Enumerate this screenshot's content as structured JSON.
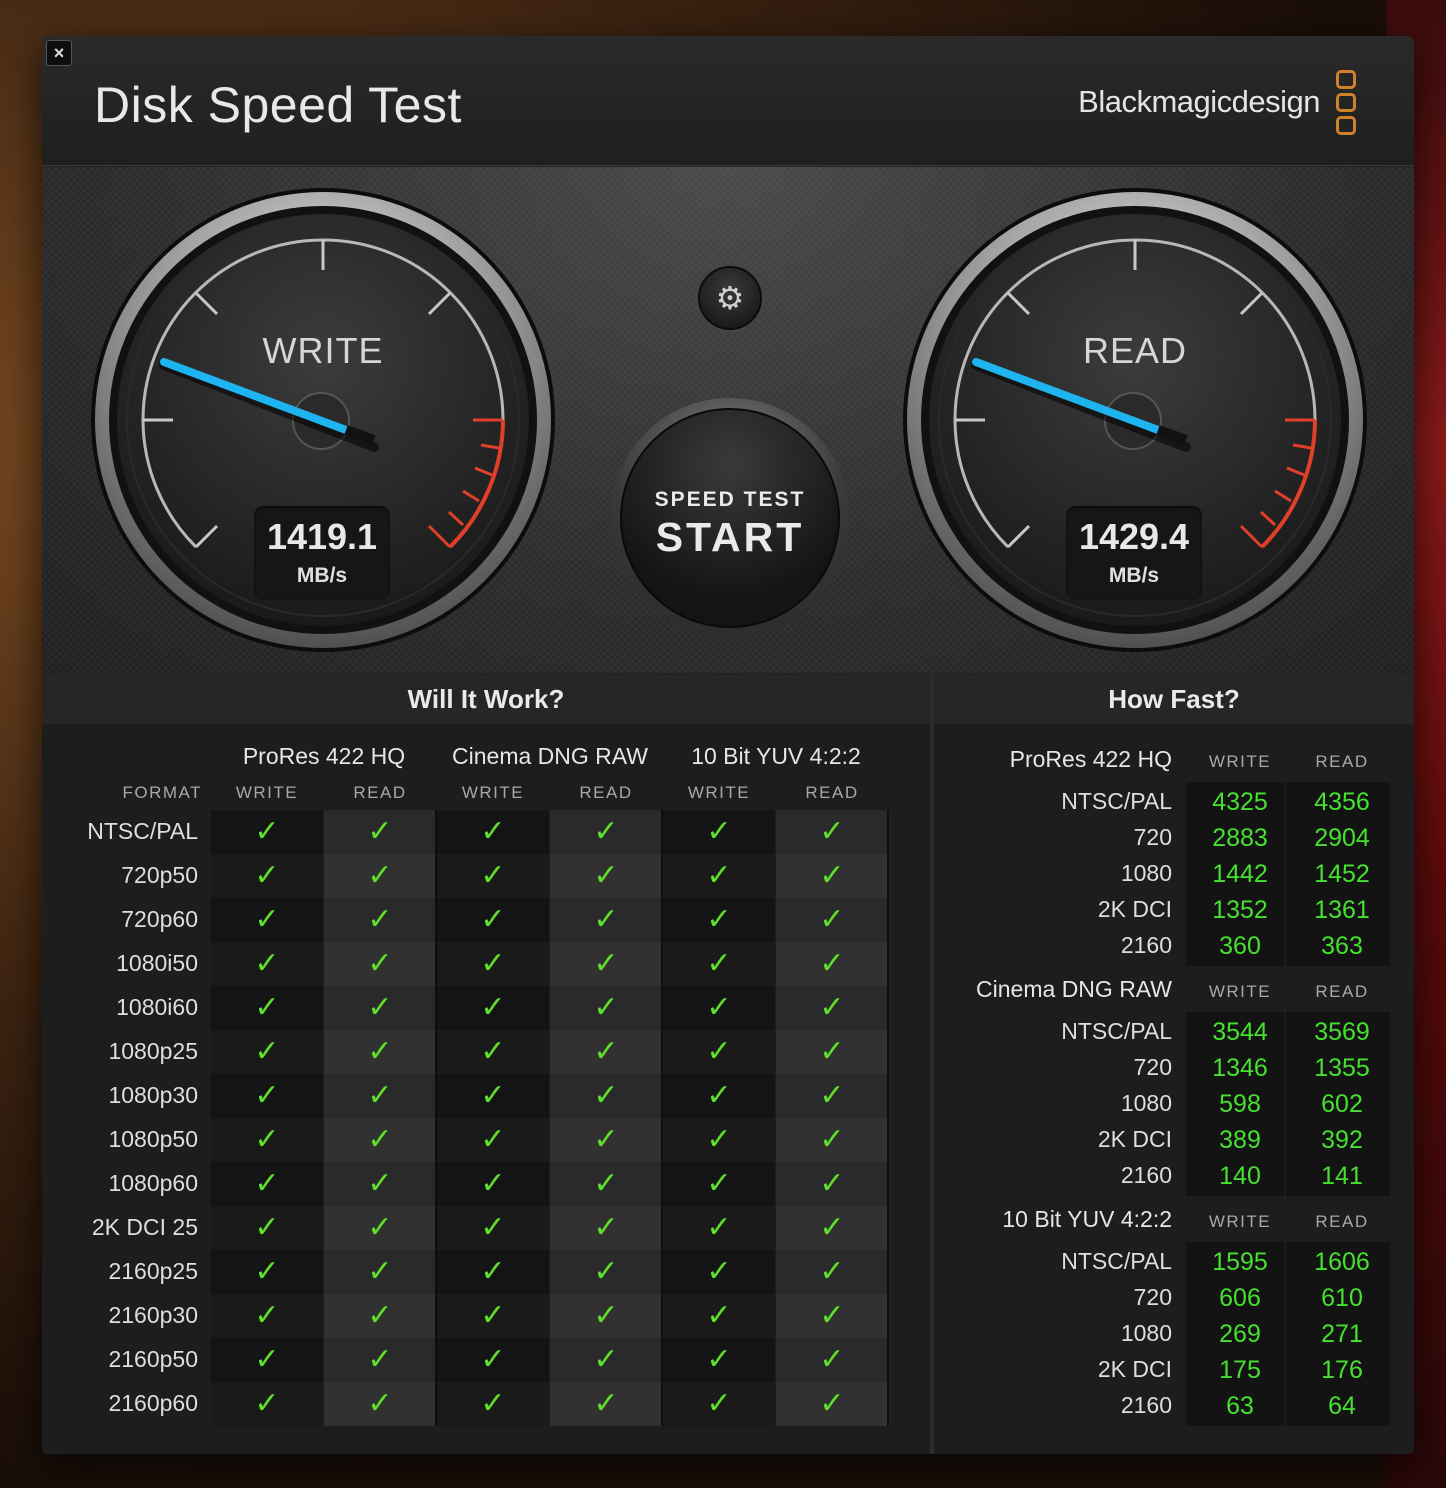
{
  "window": {
    "close_glyph": "×"
  },
  "header": {
    "title": "Disk Speed Test",
    "brand": "Blackmagicdesign",
    "brand_color": "#d0802a"
  },
  "gauges": {
    "write": {
      "label": "WRITE",
      "value": "1419.1",
      "unit": "MB/s",
      "needle_color": "#1eb4f0"
    },
    "read": {
      "label": "READ",
      "value": "1429.4",
      "unit": "MB/s",
      "needle_color": "#1eb4f0"
    }
  },
  "controls": {
    "settings_icon": "gear-icon",
    "start": {
      "line1": "SPEED TEST",
      "line2": "START"
    }
  },
  "will_it_work": {
    "title": "Will It Work?",
    "format_header": "FORMAT",
    "codecs": [
      "ProRes 422 HQ",
      "Cinema DNG RAW",
      "10 Bit YUV 4:2:2"
    ],
    "write_label": "WRITE",
    "read_label": "READ",
    "check_glyph": "✓",
    "check_color": "#5ee02a",
    "formats": [
      "NTSC/PAL",
      "720p50",
      "720p60",
      "1080i50",
      "1080i60",
      "1080p25",
      "1080p30",
      "1080p50",
      "1080p60",
      "2K DCI 25",
      "2160p25",
      "2160p30",
      "2160p50",
      "2160p60"
    ]
  },
  "how_fast": {
    "title": "How Fast?",
    "write_label": "WRITE",
    "read_label": "READ",
    "groups": [
      {
        "name": "ProRes 422 HQ",
        "rows": [
          {
            "format": "NTSC/PAL",
            "write": "4325",
            "read": "4356"
          },
          {
            "format": "720",
            "write": "2883",
            "read": "2904"
          },
          {
            "format": "1080",
            "write": "1442",
            "read": "1452"
          },
          {
            "format": "2K DCI",
            "write": "1352",
            "read": "1361"
          },
          {
            "format": "2160",
            "write": "360",
            "read": "363"
          }
        ]
      },
      {
        "name": "Cinema DNG RAW",
        "rows": [
          {
            "format": "NTSC/PAL",
            "write": "3544",
            "read": "3569"
          },
          {
            "format": "720",
            "write": "1346",
            "read": "1355"
          },
          {
            "format": "1080",
            "write": "598",
            "read": "602"
          },
          {
            "format": "2K DCI",
            "write": "389",
            "read": "392"
          },
          {
            "format": "2160",
            "write": "140",
            "read": "141"
          }
        ]
      },
      {
        "name": "10 Bit YUV 4:2:2",
        "rows": [
          {
            "format": "NTSC/PAL",
            "write": "1595",
            "read": "1606"
          },
          {
            "format": "720",
            "write": "606",
            "read": "610"
          },
          {
            "format": "1080",
            "write": "269",
            "read": "271"
          },
          {
            "format": "2K DCI",
            "write": "175",
            "read": "176"
          },
          {
            "format": "2160",
            "write": "63",
            "read": "64"
          }
        ]
      }
    ]
  }
}
